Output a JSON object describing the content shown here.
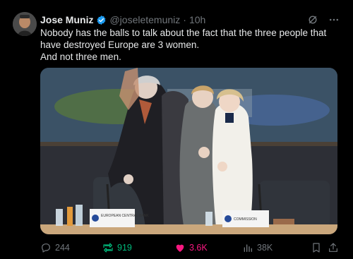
{
  "post": {
    "author_name": "Jose Muniz",
    "handle": "@joseletemuniz",
    "separator": "·",
    "time": "10h",
    "text": "Nobody has the balls to talk about the fact that the three people that have destroyed Europe are 3 women.\nAnd not three men.",
    "verified": true
  },
  "media": {
    "placard_left": "EUROPEAN CENTRAL BANK",
    "placard_right": "COMMISSION"
  },
  "actions": {
    "replies": "244",
    "reposts": "919",
    "likes": "3.6K",
    "views": "38K"
  },
  "colors": {
    "background": "#000000",
    "text": "#e7e9ea",
    "muted": "#71767b",
    "verified": "#1d9bf0",
    "repost_active": "#00ba7c",
    "like_active": "#f91880"
  },
  "icons": [
    "grok-icon",
    "more-icon",
    "verified-icon",
    "reply-icon",
    "repost-icon",
    "like-icon",
    "views-icon",
    "bookmark-icon",
    "share-icon"
  ]
}
